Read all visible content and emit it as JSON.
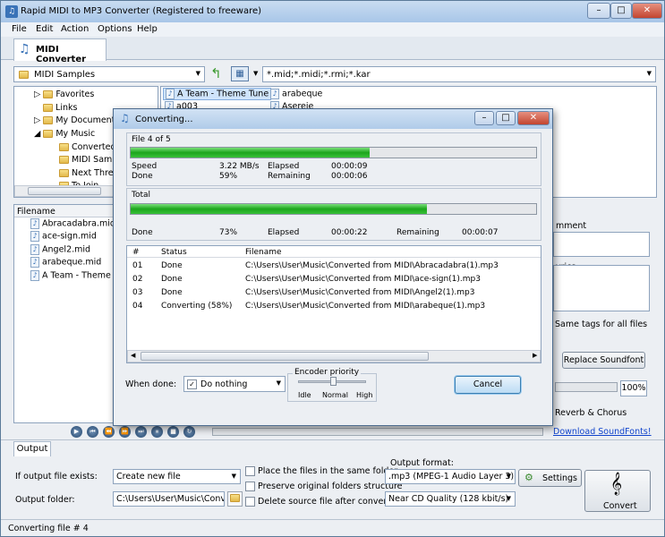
{
  "window": {
    "title": "Rapid MIDI to MP3 Converter (Registered to freeware)"
  },
  "menu": [
    "File",
    "Edit",
    "Action",
    "Options",
    "Help"
  ],
  "main_tab": "MIDI Converter",
  "folder_combo": "MIDI Samples",
  "filter": "*.mid;*.midi;*.rmi;*.kar",
  "tree": [
    "Favorites",
    "Links",
    "My Document",
    "My Music",
    "Converted",
    "MIDI Samp",
    "Next Three",
    "To Join"
  ],
  "file_grid": [
    "A Team - Theme Tune",
    "arabeque",
    "a003",
    "Asereje"
  ],
  "file_list": {
    "header": "Filename",
    "items": [
      "Abracadabra.mid",
      "ace-sign.mid",
      "Angel2.mid",
      "arabeque.mid",
      "A Team - Theme Tune"
    ]
  },
  "right_panel": {
    "comment": "mment",
    "lyrics": "yrics",
    "same_tags": "Same tags for all files",
    "replace_soundfont": "Replace Soundfont",
    "volume": "100%",
    "reverb": "Reverb & Chorus",
    "download": "Download SoundFonts!"
  },
  "output_tab": "Output",
  "output": {
    "exists_label": "If output file exists:",
    "exists_value": "Create new file",
    "folder_label": "Output folder:",
    "folder_value": "C:\\Users\\User\\Music\\Converte",
    "opt_same_folder": "Place the files in the same folder",
    "opt_preserve": "Preserve original folders structure",
    "opt_delete": "Delete source file after conversion",
    "format_label": "Output format:",
    "format_value": ".mp3 (MPEG-1 Audio Layer 3)",
    "quality_value": "Near CD Quality (128 kbit/s)",
    "settings": "Settings",
    "convert": "Convert"
  },
  "status_bar": "Converting file # 4",
  "dialog": {
    "title": "Converting...",
    "file_label": "File 4 of 5",
    "file_progress": 0.59,
    "speed_label": "Speed",
    "speed_value": "3.22 MB/s",
    "done_label": "Done",
    "done_value": "59%",
    "elapsed_label": "Elapsed",
    "elapsed_value": "00:00:09",
    "remaining_label": "Remaining",
    "remaining_value": "00:00:06",
    "total_label": "Total",
    "total_progress": 0.73,
    "total_done_label": "Done",
    "total_done_value": "73%",
    "total_elapsed_label": "Elapsed",
    "total_elapsed_value": "00:00:22",
    "total_remaining_label": "Remaining",
    "total_remaining_value": "00:00:07",
    "columns": [
      "#",
      "Status",
      "Filename"
    ],
    "rows": [
      [
        "01",
        "Done",
        "C:\\Users\\User\\Music\\Converted from MIDI\\Abracadabra(1).mp3"
      ],
      [
        "02",
        "Done",
        "C:\\Users\\User\\Music\\Converted from MIDI\\ace-sign(1).mp3"
      ],
      [
        "03",
        "Done",
        "C:\\Users\\User\\Music\\Converted from MIDI\\Angel2(1).mp3"
      ],
      [
        "04",
        "Converting (58%)",
        "C:\\Users\\User\\Music\\Converted from MIDI\\arabeque(1).mp3"
      ]
    ],
    "when_done_label": "When done:",
    "when_done_value": "Do nothing",
    "priority_label": "Encoder priority",
    "priority_levels": [
      "Idle",
      "Normal",
      "High"
    ],
    "cancel": "Cancel"
  }
}
